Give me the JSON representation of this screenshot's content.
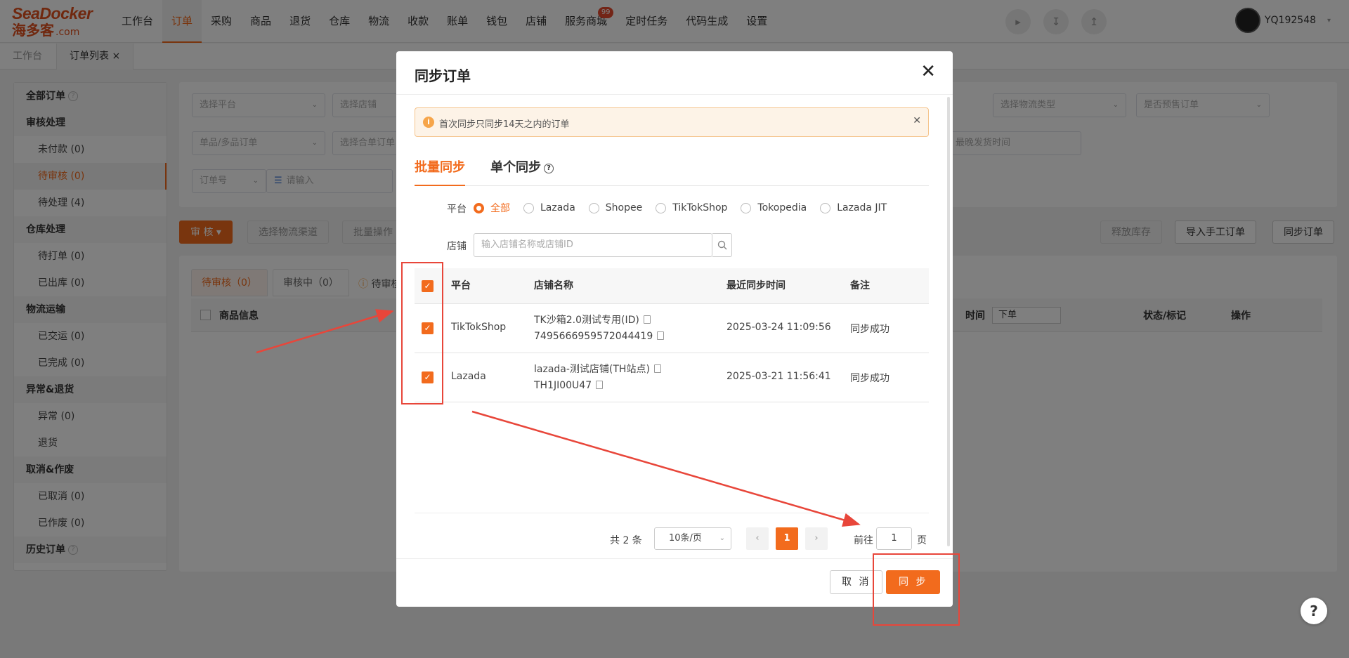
{
  "header": {
    "logo_top": "SeaDocker",
    "logo_cn": "海多客",
    "logo_suffix": ".com",
    "nav": [
      "工作台",
      "订单",
      "采购",
      "商品",
      "退货",
      "仓库",
      "物流",
      "收款",
      "账单",
      "钱包",
      "店铺",
      "服务商城",
      "定时任务",
      "代码生成",
      "设置"
    ],
    "nav_active_index": 1,
    "nav_badge": "99",
    "username": "YQ192548"
  },
  "page_tabs": [
    {
      "label": "工作台"
    },
    {
      "label": "订单列表 ×"
    }
  ],
  "sidebar": {
    "groups": [
      {
        "title": "全部订单",
        "help": true,
        "items": []
      },
      {
        "title": "审核处理",
        "items": [
          "未付款 (0)",
          "待审核 (0)",
          "待处理 (4)"
        ]
      },
      {
        "title": "仓库处理",
        "items": [
          "待打单 (0)",
          "已出库 (0)"
        ]
      },
      {
        "title": "物流运输",
        "items": [
          "已交运 (0)",
          "已完成 (0)"
        ]
      },
      {
        "title": "异常&退货",
        "items": [
          "异常 (0)",
          "退货"
        ]
      },
      {
        "title": "取消&作废",
        "items": [
          "已取消 (0)",
          "已作废 (0)"
        ]
      },
      {
        "title": "历史订单",
        "help": true,
        "items": []
      }
    ],
    "active_item": "待审核 (0)"
  },
  "filters": {
    "platform": "选择平台",
    "shop": "选择店铺",
    "logistics_type": "选择物流类型",
    "presale": "是否预售订单",
    "single_multi": "单品/多品订单",
    "merge": "选择合单订单",
    "latest_ship": "最晚发货时间",
    "order_no": "订单号",
    "input_placeholder": "请输入"
  },
  "toolbar": {
    "review": "审 核",
    "choose_channel": "选择物流渠道",
    "batch": "批量操作",
    "release_stock": "释放库存",
    "import_manual": "导入手工订单",
    "sync_orders": "同步订单"
  },
  "list": {
    "tabs": [
      "待审核（0）",
      "审核中（0）"
    ],
    "notice": "待审核",
    "columns": {
      "goods": "商品信息",
      "time": "时间",
      "time_sort": "下单",
      "status": "状态/标记",
      "action": "操作"
    }
  },
  "modal": {
    "title": "同步订单",
    "alert": "首次同步只同步14天之内的订单",
    "tabs": [
      "批量同步",
      "单个同步"
    ],
    "platform_label": "平台",
    "platforms": [
      "全部",
      "Lazada",
      "Shopee",
      "TikTokShop",
      "Tokopedia",
      "Lazada JIT"
    ],
    "platform_selected": 0,
    "shop_label": "店铺",
    "shop_placeholder": "输入店铺名称或店铺ID",
    "columns": {
      "platform": "平台",
      "shop": "店铺名称",
      "last_sync": "最近同步时间",
      "remark": "备注"
    },
    "rows": [
      {
        "platform": "TikTokShop",
        "shop_name": "TK沙箱2.0测试专用(ID)",
        "shop_id": "7495666959572044419",
        "last_sync": "2025-03-24 11:09:56",
        "remark": "同步成功",
        "checked": true
      },
      {
        "platform": "Lazada",
        "shop_name": "lazada-测试店铺(TH站点)",
        "shop_id": "TH1JI00U47",
        "last_sync": "2025-03-21 11:56:41",
        "remark": "同步成功",
        "checked": true
      }
    ],
    "pager": {
      "total": "共 2 条",
      "page_size": "10条/页",
      "current": "1",
      "goto_label": "前往",
      "goto_value": "1",
      "unit": "页"
    },
    "cancel": "取 消",
    "ok": "同 步"
  },
  "colors": {
    "accent": "#f26b1d",
    "annotation": "#e8463a"
  },
  "help_button": "?"
}
